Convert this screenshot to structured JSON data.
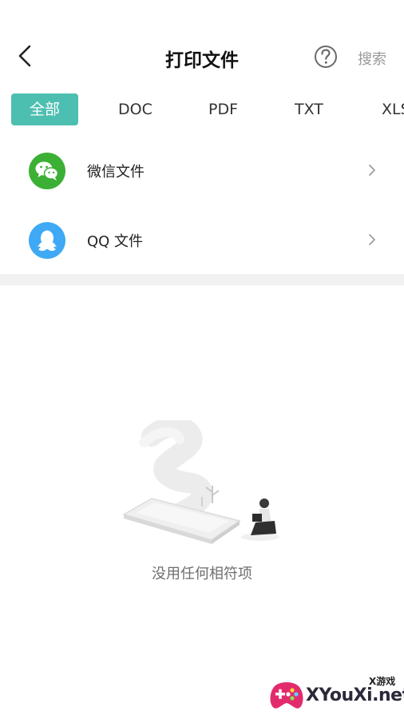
{
  "header": {
    "title": "打印文件",
    "back_icon": "chevron-left-icon",
    "help_icon": "question-circle-icon",
    "search_label": "搜索"
  },
  "tabs": [
    {
      "label": "全部",
      "active": true
    },
    {
      "label": "DOC",
      "active": false
    },
    {
      "label": "PDF",
      "active": false
    },
    {
      "label": "TXT",
      "active": false
    },
    {
      "label": "XLS",
      "active": false
    }
  ],
  "sources": [
    {
      "label": "微信文件",
      "icon": "wechat-icon",
      "color": "#3cb035"
    },
    {
      "label": "QQ 文件",
      "icon": "qq-icon",
      "color": "#3fa9f5"
    }
  ],
  "empty_state": {
    "message": "没用任何相符项",
    "icon": "empty-illustration-icon"
  },
  "watermark": {
    "brand": "XYouXi.net",
    "small": "X游戏"
  },
  "colors": {
    "accent": "#4dbfb1",
    "divider": "#f1f1f1",
    "muted_text": "#9a9a9a"
  }
}
